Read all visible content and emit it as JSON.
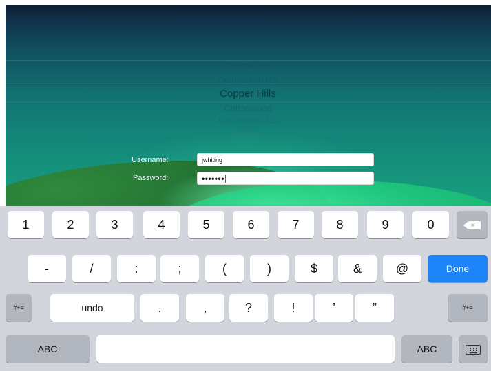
{
  "school_picker": {
    "items": [
      "Churchill JHS",
      "Connection HS",
      "Copper Hills",
      "Cottonwood",
      "Cottonwood HS",
      "Draper Park"
    ],
    "selected": "Copper Hills"
  },
  "login": {
    "username_label": "Username:",
    "password_label": "Password:",
    "username_value": "jwhiting",
    "password_value": "•••••••"
  },
  "keyboard": {
    "row1": [
      "1",
      "2",
      "3",
      "4",
      "5",
      "6",
      "7",
      "8",
      "9",
      "0"
    ],
    "backspace_icon": "backspace-icon",
    "row2": [
      "-",
      "/",
      ":",
      ";",
      "(",
      ")",
      "$",
      "&",
      "@"
    ],
    "done_label": "Done",
    "row3_left": "#+=",
    "undo_label": "undo",
    "row3": [
      ".",
      ",",
      "?",
      "!",
      "’",
      "”"
    ],
    "row3_right": "#+=",
    "abc_left": "ABC",
    "abc_right": "ABC",
    "hide_keyboard_icon": "keyboard-dismiss-icon",
    "done_color": "#1d84f7"
  }
}
